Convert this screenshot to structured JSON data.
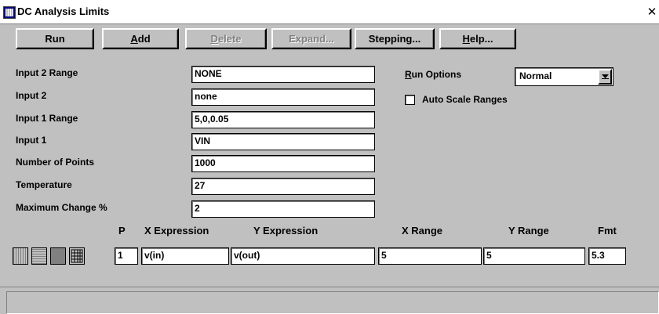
{
  "window": {
    "title": "DC Analysis Limits",
    "close_glyph": "✕"
  },
  "toolbar": [
    {
      "label": "Run",
      "mnemonic_index": -1,
      "enabled": true
    },
    {
      "label": "Add",
      "mnemonic_index": 0,
      "enabled": true
    },
    {
      "label": "Delete",
      "mnemonic_index": 0,
      "enabled": false
    },
    {
      "label": "Expand...",
      "mnemonic_index": -1,
      "enabled": false
    },
    {
      "label": "Stepping...",
      "mnemonic_index": -1,
      "enabled": true
    },
    {
      "label": "Help...",
      "mnemonic_index": 0,
      "enabled": true
    }
  ],
  "fields": [
    {
      "label": "Input 2 Range",
      "value": "NONE"
    },
    {
      "label": "Input 2",
      "value": "none"
    },
    {
      "label": "Input 1 Range",
      "value": "5,0,0.05"
    },
    {
      "label": "Input 1",
      "value": "VIN"
    },
    {
      "label": "Number of Points",
      "value": "1000"
    },
    {
      "label": "Temperature",
      "value": "27"
    },
    {
      "label": "Maximum Change %",
      "value": "2"
    }
  ],
  "run_options": {
    "label": "Run Options",
    "value": "Normal"
  },
  "auto_scale": {
    "label": "Auto Scale Ranges",
    "checked": false
  },
  "table": {
    "headers": {
      "p": "P",
      "x_expr": "X Expression",
      "y_expr": "Y Expression",
      "x_range": "X Range",
      "y_range": "Y Range",
      "fmt": "Fmt"
    },
    "row": {
      "p": "1",
      "x_expr": "v(in)",
      "y_expr": "v(out)",
      "x_range": "5",
      "y_range": "5",
      "fmt": "5.3"
    }
  },
  "colors": {
    "face": "#c0c0c0",
    "shadow": "#808080",
    "highlight": "#ffffff",
    "icon_blue": "#000080"
  }
}
